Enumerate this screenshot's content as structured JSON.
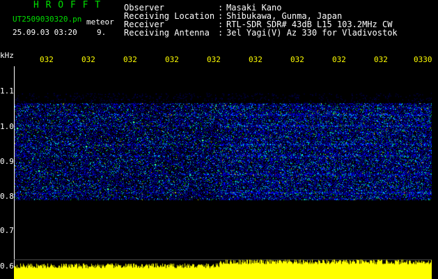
{
  "header": {
    "app_title": "H R O F F T",
    "file_name": "UT2509030320.pn",
    "meteor_label": "meteor",
    "date_time": "25.09.03 03:20",
    "index": "9."
  },
  "info": {
    "rows": [
      {
        "label": "Observer",
        "value": "Masaki Kano"
      },
      {
        "label": "Receiving Location",
        "value": "Shibukawa, Gunma, Japan"
      },
      {
        "label": "Receiver",
        "value": "RTL-SDR SDR# 43dB L15 103.2MHz CW"
      },
      {
        "label": "Receiving Antenna",
        "value": "3el Yagi(V) Az 330 for Vladivostok"
      }
    ],
    "separator": ":"
  },
  "axes": {
    "y_unit": "kHz",
    "y_ticks": [
      "1.1",
      "1.0",
      "0.9",
      "0.8",
      "0.7",
      "0.6"
    ],
    "x_ticks": [
      "032",
      "032",
      "032",
      "032",
      "032",
      "032",
      "032",
      "032",
      "032",
      "0330"
    ]
  },
  "chart_data": {
    "type": "heatmap",
    "ylabel": "kHz",
    "ylim": [
      0.6,
      1.1
    ],
    "x_tick_labels": [
      "032",
      "032",
      "032",
      "032",
      "032",
      "032",
      "032",
      "032",
      "032",
      "0330"
    ],
    "active_band_khz": [
      0.76,
      1.02
    ],
    "bright_lines_khz": [
      0.78,
      0.83,
      0.88,
      0.91,
      0.96,
      0.99
    ],
    "activity_increase_at_fraction": 0.49,
    "colormap": [
      "#000080",
      "#0000ff",
      "#00ffff",
      "#00ff00",
      "#ffff00",
      "#ff0000"
    ],
    "signal_bar_color": "#ffff00"
  },
  "colors": {
    "background": "#000000",
    "title_green": "#00e000",
    "tick_yellow": "#ffff00",
    "text_white": "#ffffff"
  }
}
